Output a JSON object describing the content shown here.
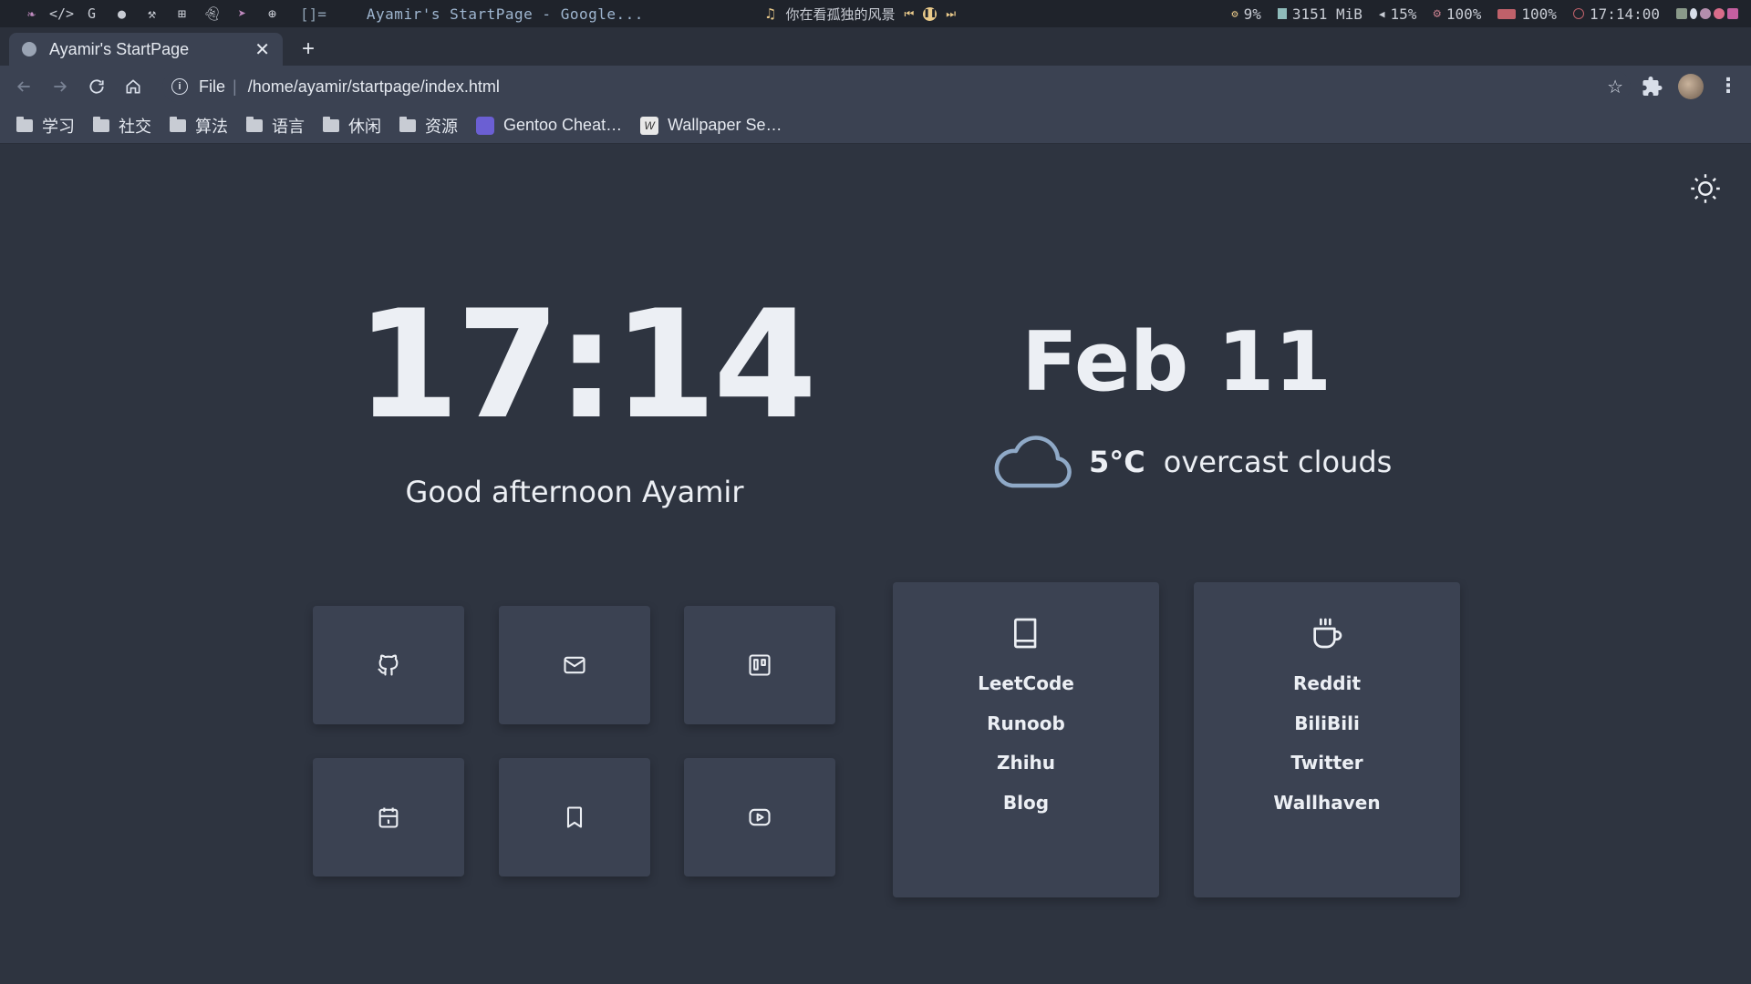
{
  "system_bar": {
    "layout_indicator": "[]=",
    "window_title": "Ayamir's StartPage - Google...",
    "music_title": "你在看孤独的风景",
    "cpu": "9%",
    "memory": "3151 MiB",
    "volume": "15%",
    "brightness": "100%",
    "battery": "100%",
    "time": "17:14:00"
  },
  "browser": {
    "tab_title": "Ayamir's StartPage",
    "address_scheme": "File",
    "address_path": "/home/ayamir/startpage/index.html"
  },
  "bookmarks": [
    {
      "label": "学习",
      "type": "folder"
    },
    {
      "label": "社交",
      "type": "folder"
    },
    {
      "label": "算法",
      "type": "folder"
    },
    {
      "label": "语言",
      "type": "folder"
    },
    {
      "label": "休闲",
      "type": "folder"
    },
    {
      "label": "资源",
      "type": "folder"
    },
    {
      "label": "Gentoo Cheat…",
      "type": "link"
    },
    {
      "label": "Wallpaper Se…",
      "type": "link"
    }
  ],
  "startpage": {
    "clock": "17:14",
    "greeting": "Good afternoon Ayamir",
    "date": "Feb 11",
    "weather": {
      "temp": "5°C",
      "description": "overcast clouds",
      "icon": "cloud-icon"
    },
    "tiles": [
      {
        "icon": "github-icon"
      },
      {
        "icon": "mail-icon"
      },
      {
        "icon": "trello-icon"
      },
      {
        "icon": "calendar-icon"
      },
      {
        "icon": "bookmark-icon"
      },
      {
        "icon": "youtube-icon"
      }
    ],
    "cards": [
      {
        "icon": "book-icon",
        "links": [
          "LeetCode",
          "Runoob",
          "Zhihu",
          "Blog"
        ]
      },
      {
        "icon": "coffee-icon",
        "links": [
          "Reddit",
          "BiliBili",
          "Twitter",
          "Wallhaven"
        ]
      }
    ]
  },
  "colors": {
    "background": "#2e3440",
    "card": "#3b4252",
    "text": "#eceff4",
    "weather_icon": "#8fa9c7"
  }
}
